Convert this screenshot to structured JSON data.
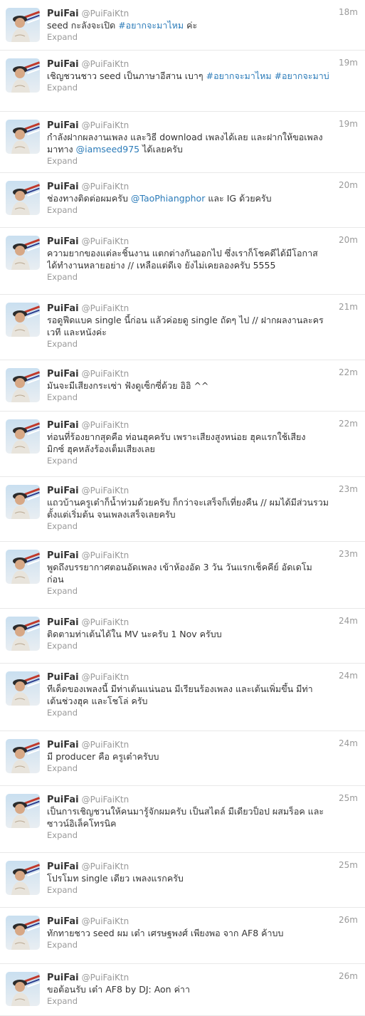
{
  "tweets": [
    {
      "name": "PuiFai",
      "handle": "@PuiFaiKtn",
      "time": "18m",
      "lines": [
        [
          {
            "t": "seed กะลังจะเปิด "
          },
          {
            "t": "#อยากจะมาไหม",
            "link": true
          },
          {
            "t": " ค่ะ"
          }
        ]
      ],
      "expand": "Expand"
    },
    {
      "name": "PuiFai",
      "handle": "@PuiFaiKtn",
      "time": "19m",
      "lines": [
        [
          {
            "t": "เชิญชวนชาว seed เป็นภาษาอีสาน เบาๆ "
          },
          {
            "t": "#อยากจะมาไหม",
            "link": true
          },
          {
            "t": " "
          },
          {
            "t": "#อยากจะมาบ่",
            "link": true
          }
        ]
      ],
      "expand": "Expand"
    },
    {
      "name": "PuiFai",
      "handle": "@PuiFaiKtn",
      "time": "19m",
      "lines": [
        [
          {
            "t": "กำลังฝากผลงานเพลง และวิธี download เพลงได้เลย และฝากให้ขอเพลง"
          }
        ],
        [
          {
            "t": "มาทาง "
          },
          {
            "t": "@iamseed975",
            "link": true
          },
          {
            "t": " ได้เลยครับ"
          }
        ]
      ],
      "expand": "Expand"
    },
    {
      "name": "PuiFai",
      "handle": "@PuiFaiKtn",
      "time": "20m",
      "lines": [
        [
          {
            "t": "ช่องทางติดต่อผมครับ "
          },
          {
            "t": "@TaoPhiangphor",
            "link": true
          },
          {
            "t": " และ IG ด้วยครับ"
          }
        ]
      ],
      "expand": "Expand"
    },
    {
      "name": "PuiFai",
      "handle": "@PuiFaiKtn",
      "time": "20m",
      "lines": [
        [
          {
            "t": "ความยากของแต่ละชิ้นงาน แตกต่างกันออกไป ซึ่งเราก็โชคดีได้มีโอกาส"
          }
        ],
        [
          {
            "t": "ได้ทำงานหลายอย่าง // เหลือแต่ดีเจ ยังไม่เคยลองครับ 5555"
          }
        ]
      ],
      "expand": "Expand"
    },
    {
      "name": "PuiFai",
      "handle": "@PuiFaiKtn",
      "time": "21m",
      "lines": [
        [
          {
            "t": "รอดูฟีดแบค single นี้ก่อน แล้วค่อยดู single ถัดๆ ไป // ฝากผลงานละคร"
          }
        ],
        [
          {
            "t": "เวที และหนังค่ะ"
          }
        ]
      ],
      "expand": "Expand"
    },
    {
      "name": "PuiFai",
      "handle": "@PuiFaiKtn",
      "time": "22m",
      "lines": [
        [
          {
            "t": "มันจะมีเสียงกระเซ่า ฟังดูเซ็กซี่ด้วย อิอิ ^^"
          }
        ]
      ],
      "expand": "Expand"
    },
    {
      "name": "PuiFai",
      "handle": "@PuiFaiKtn",
      "time": "22m",
      "lines": [
        [
          {
            "t": "ท่อนที่ร้องยากสุดคือ ท่อนฮุคครับ เพราะเสียงสูงหน่อย ฮุคแรกใช้เสียง"
          }
        ],
        [
          {
            "t": "มิกซ์ ฮุคหลังร้องเต็มเสียงเลย"
          }
        ]
      ],
      "expand": "Expand"
    },
    {
      "name": "PuiFai",
      "handle": "@PuiFaiKtn",
      "time": "23m",
      "lines": [
        [
          {
            "t": "แถวบ้านครูเต๋าก็น้ำท่วมด้วยครับ ก็กว่าจะเสร็จก็เที่ยงคืน // ผมได้มีส่วนรวม"
          }
        ],
        [
          {
            "t": "ตั้งแต่เริ่มต้น จนเพลงเสร็จเลยครับ"
          }
        ]
      ],
      "expand": "Expand"
    },
    {
      "name": "PuiFai",
      "handle": "@PuiFaiKtn",
      "time": "23m",
      "lines": [
        [
          {
            "t": "พูดถึงบรรยากาศตอนอัดเพลง เข้าห้องอัด 3 วัน วันแรกเช็คคีย์ อัดเดโม"
          }
        ],
        [
          {
            "t": "ก่อน"
          }
        ]
      ],
      "expand": "Expand"
    },
    {
      "name": "PuiFai",
      "handle": "@PuiFaiKtn",
      "time": "24m",
      "lines": [
        [
          {
            "t": "ติดตามท่าเต้นได้ใน MV นะครับ 1 Nov ครับบ"
          }
        ]
      ],
      "expand": "Expand"
    },
    {
      "name": "PuiFai",
      "handle": "@PuiFaiKtn",
      "time": "24m",
      "lines": [
        [
          {
            "t": "ทีเด็ดของเพลงนี้ มีท่าเต้นแน่นอน มีเรียนร้องเพลง และเต้นเพิ่มขึ้น มีท่า"
          }
        ],
        [
          {
            "t": "เต้นช่วงฮุค และโชโล่ ครับ"
          }
        ]
      ],
      "expand": "Expand"
    },
    {
      "name": "PuiFai",
      "handle": "@PuiFaiKtn",
      "time": "24m",
      "lines": [
        [
          {
            "t": "มี producer คือ ครูเต๋าครับบ"
          }
        ]
      ],
      "expand": "Expand"
    },
    {
      "name": "PuiFai",
      "handle": "@PuiFaiKtn",
      "time": "25m",
      "lines": [
        [
          {
            "t": "เป็นการเชิญชวนให้คนมารู้จักผมครับ เป็นสไตล์ มีเดียวป็อป ผสมร็อค และ"
          }
        ],
        [
          {
            "t": "ซาวน์อิเล็คโทรนิค"
          }
        ]
      ],
      "expand": "Expand"
    },
    {
      "name": "PuiFai",
      "handle": "@PuiFaiKtn",
      "time": "25m",
      "lines": [
        [
          {
            "t": "โปรโมท single เดียว เพลงแรกครับ"
          }
        ]
      ],
      "expand": "Expand"
    },
    {
      "name": "PuiFai",
      "handle": "@PuiFaiKtn",
      "time": "26m",
      "lines": [
        [
          {
            "t": "ทักทายชาว seed ผม เต๋า เศรษฐพงศ์ เพียงพอ จาก AF8 ค้าบบ"
          }
        ]
      ],
      "expand": "Expand"
    },
    {
      "name": "PuiFai",
      "handle": "@PuiFaiKtn",
      "time": "26m",
      "lines": [
        [
          {
            "t": "ขอต้อนรับ เต๋า AF8 by DJ: Aon ค่าา"
          }
        ]
      ],
      "expand": "Expand"
    }
  ]
}
